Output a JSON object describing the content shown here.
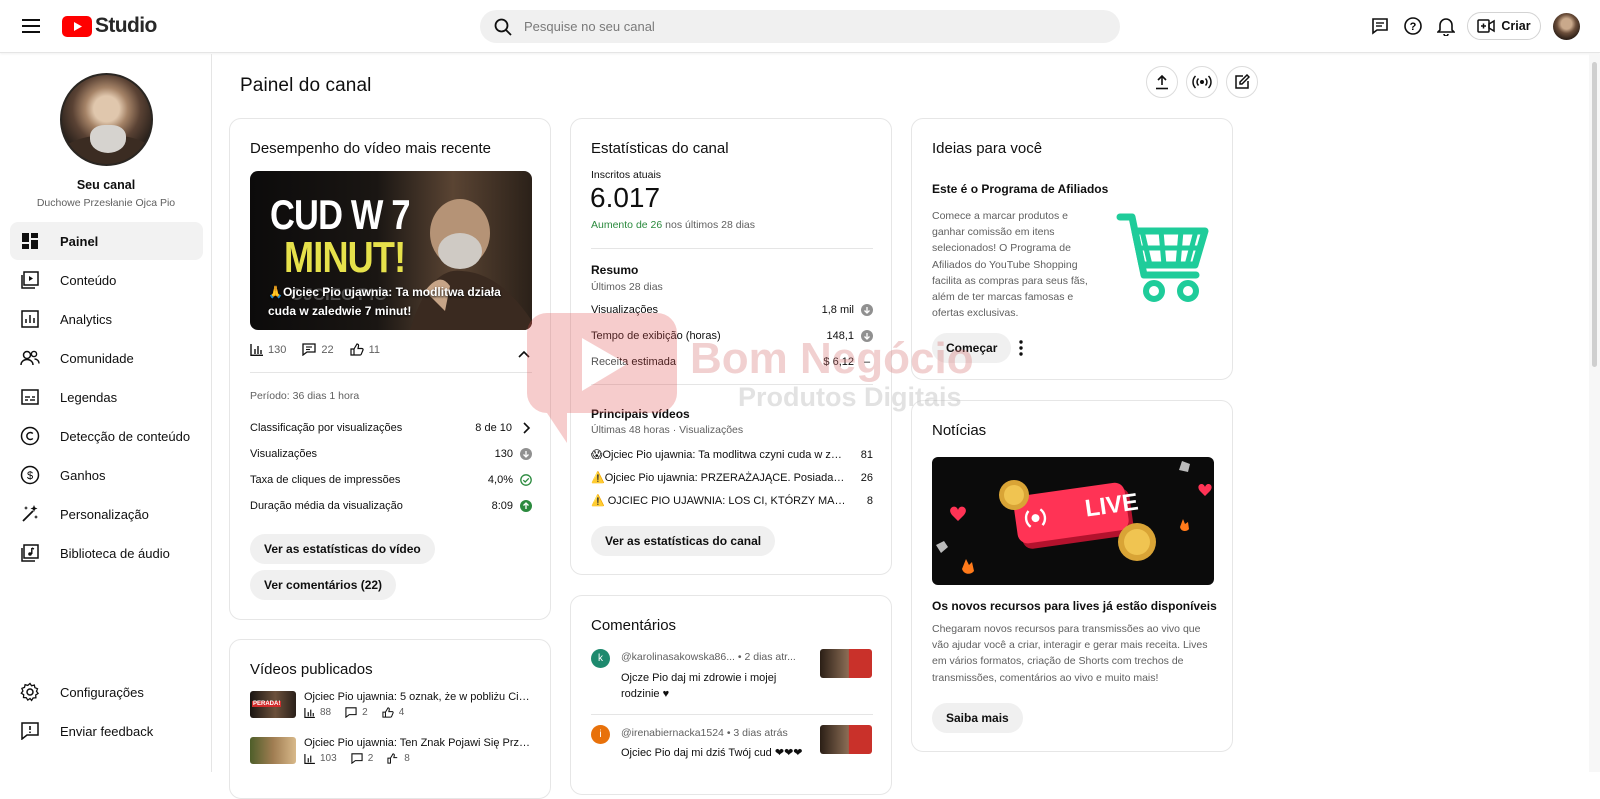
{
  "app": {
    "logo_text": "Studio",
    "brand_color": "#ff0000"
  },
  "search": {
    "placeholder": "Pesquise no seu canal"
  },
  "topbar": {
    "create_label": "Criar"
  },
  "sidebar": {
    "channel_title": "Seu canal",
    "channel_name": "Duchowe Przesłanie Ojca Pio",
    "items": [
      {
        "label": "Painel",
        "icon": "dashboard-icon",
        "active": true
      },
      {
        "label": "Conteúdo",
        "icon": "content-icon"
      },
      {
        "label": "Analytics",
        "icon": "analytics-icon"
      },
      {
        "label": "Comunidade",
        "icon": "community-icon"
      },
      {
        "label": "Legendas",
        "icon": "subtitles-icon"
      },
      {
        "label": "Detecção de conteúdo",
        "icon": "copyright-icon"
      },
      {
        "label": "Ganhos",
        "icon": "earn-icon"
      },
      {
        "label": "Personalização",
        "icon": "customization-icon"
      },
      {
        "label": "Biblioteca de áudio",
        "icon": "audio-library-icon"
      }
    ],
    "bottom": [
      {
        "label": "Configurações",
        "icon": "settings-icon"
      },
      {
        "label": "Enviar feedback",
        "icon": "feedback-icon"
      }
    ]
  },
  "page": {
    "title": "Painel do canal"
  },
  "latest_video": {
    "title": "Desempenho do vídeo mais recente",
    "thumb_text_top": "CUD W 7",
    "thumb_text_bottom": "MINUT!",
    "thumb_overlay_text": "OJCIEC PIO",
    "caption": "🙏Ojciec Pio ujawnia: Ta modlitwa działa cuda w zaledwie 7 minut!",
    "views": "130",
    "comments": "22",
    "likes": "11",
    "period": "Período: 36 dias 1 hora",
    "metrics": [
      {
        "label": "Classificação por visualizações",
        "value": "8 de 10",
        "indicator": "chevron"
      },
      {
        "label": "Visualizações",
        "value": "130",
        "indicator": "down-gray"
      },
      {
        "label": "Taxa de cliques de impressões",
        "value": "4,0%",
        "indicator": "check-green"
      },
      {
        "label": "Duração média da visualização",
        "value": "8:09",
        "indicator": "up-green"
      }
    ],
    "btn_stats": "Ver as estatísticas do vídeo",
    "btn_comments": "Ver comentários (22)"
  },
  "published": {
    "title": "Vídeos publicados",
    "items": [
      {
        "title": "Ojciec Pio ujawnia: 5 oznak, że w pobliżu Ciebie...",
        "views": "88",
        "comments": "2",
        "likes": "4",
        "thumb_label": "PERADA!"
      },
      {
        "title": "Ojciec Pio ujawnia: Ten Znak Pojawi Się Przed ...",
        "views": "103",
        "comments": "2",
        "likes": "8"
      }
    ]
  },
  "channel_stats": {
    "title": "Estatísticas do canal",
    "subs_label": "Inscritos atuais",
    "subs_value": "6.017",
    "subs_change_green": "Aumento de 26",
    "subs_change_rest": " nos últimos 28 dias",
    "summary_title": "Resumo",
    "summary_period": "Últimos 28 dias",
    "summary": [
      {
        "label": "Visualizações",
        "value": "1,8 mil",
        "indicator": "down-gray"
      },
      {
        "label": "Tempo de exibição (horas)",
        "value": "148,1",
        "indicator": "down-gray"
      },
      {
        "label": "Receita estimada",
        "value": "$ 6,12",
        "indicator": "dash"
      }
    ],
    "top_title": "Principais vídeos",
    "top_period": "Últimas 48 horas · Visualizações",
    "top_videos": [
      {
        "title": "😱Ojciec Pio ujawnia: Ta modlitwa czyni cuda w zaled...",
        "value": "81"
      },
      {
        "title": "⚠️Ojciec Pio ujawnia: PRZERAŻAJĄCE. Posiadanie lit...",
        "value": "26"
      },
      {
        "title": "⚠️ OJCIEC PIO UJAWNIA: LOS CI, KTÓRZY MAJĄ KO...",
        "value": "8"
      }
    ],
    "btn": "Ver as estatísticas do canal"
  },
  "comments": {
    "title": "Comentários",
    "items": [
      {
        "initial": "k",
        "author": "@karolinasakowska86...",
        "time": "• 2 dias atr...",
        "text": "Ojcze Pio daj mi zdrowie i mojej rodzinie ♥",
        "avatar_color": "#1e8a6e"
      },
      {
        "initial": "i",
        "author": "@irenabiernacka1524",
        "time": "• 3 dias atrás",
        "text": "Ojciec Pio daj mi dziś  Twój cud ❤❤❤",
        "avatar_color": "#e8710a"
      }
    ]
  },
  "ideas": {
    "title": "Ideias para você",
    "heading": "Este é o Programa de Afiliados",
    "body": "Comece a marcar produtos e ganhar comissão em itens selecionados! O Programa de Afiliados do YouTube Shopping facilita as compras para seus fãs, além de ter marcas famosas e ofertas exclusivas.",
    "btn": "Começar",
    "cart_color": "#1fcc9a"
  },
  "news": {
    "title": "Notícias",
    "live_label": "LIVE",
    "heading": "Os novos recursos para lives já estão disponíveis",
    "body": "Chegaram novos recursos para transmissões ao vivo que vão ajudar você a criar, interagir e gerar mais receita. Lives em vários formatos, criação de Shorts com trechos de transmissões, comentários ao vivo e muito mais!",
    "btn": "Saiba mais"
  },
  "watermark": {
    "line1": "Bom Negócio",
    "line2": "Produtos Digitais"
  }
}
